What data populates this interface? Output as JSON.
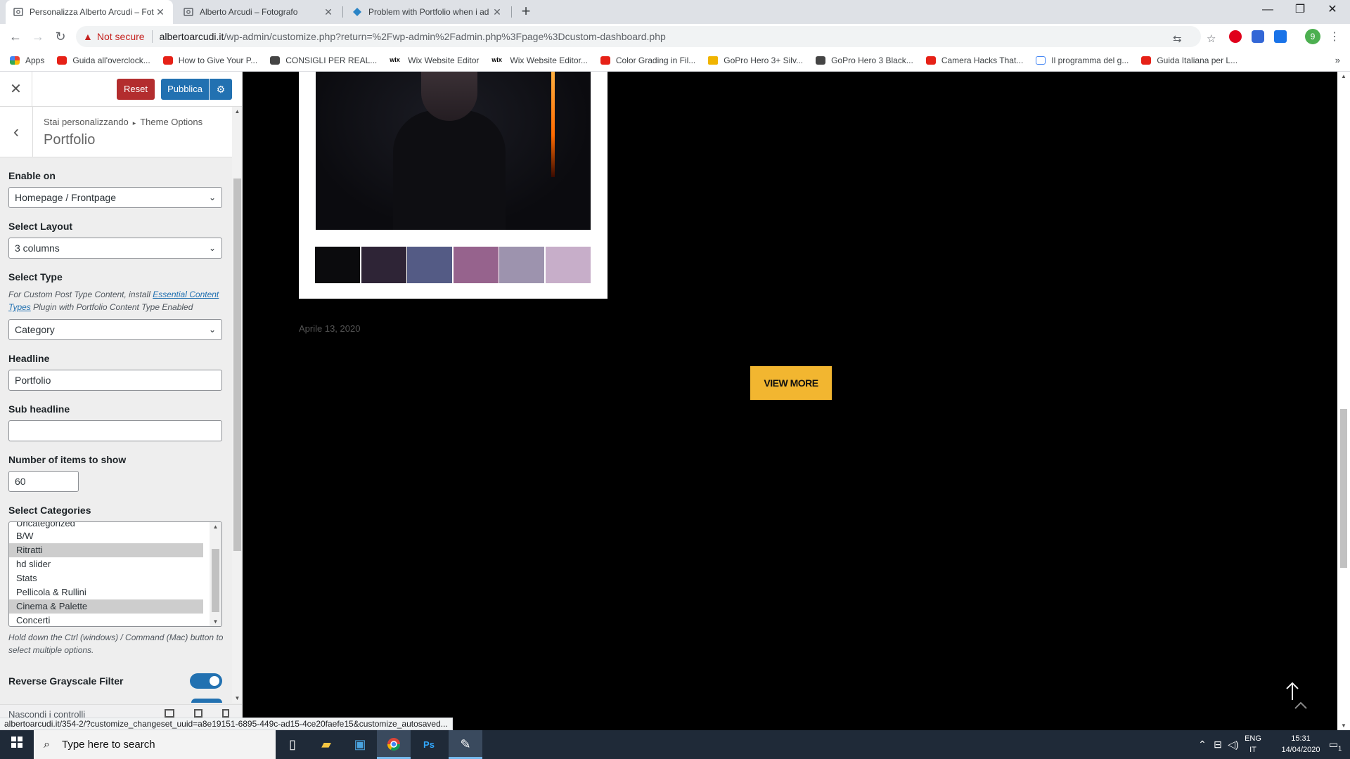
{
  "browser": {
    "tabs": [
      {
        "title": "Personalizza Alberto Arcudi – Fot",
        "active": true
      },
      {
        "title": "Alberto Arcudi – Fotografo",
        "active": false
      },
      {
        "title": "Problem with Portfolio when i ad",
        "active": false
      }
    ],
    "new_tab": "+",
    "window": {
      "minimize": "—",
      "restore": "❐",
      "close": "✕"
    },
    "nav": {
      "back": "←",
      "forward": "→",
      "reload": "↻"
    },
    "not_secure": "Not secure",
    "url_host": "albertoarcudi.it",
    "url_path": "/wp-admin/customize.php?return=%2Fwp-admin%2Fadmin.php%3Fpage%3Dcustom-dashboard.php",
    "profile_initial": "9",
    "bookmarks": [
      {
        "label": "Apps",
        "icon": "grid"
      },
      {
        "label": "Guida all'overclock...",
        "icon": "yt"
      },
      {
        "label": "How to Give Your P...",
        "icon": "yt"
      },
      {
        "label": "CONSIGLI PER REAL...",
        "icon": "gen"
      },
      {
        "label": "Wix Website Editor",
        "icon": "wix"
      },
      {
        "label": "Wix Website Editor...",
        "icon": "wix"
      },
      {
        "label": "Color Grading in Fil...",
        "icon": "yt"
      },
      {
        "label": "GoPro Hero 3+ Silv...",
        "icon": "gopro"
      },
      {
        "label": "GoPro Hero 3 Black...",
        "icon": "gen"
      },
      {
        "label": "Camera Hacks That...",
        "icon": "yt"
      },
      {
        "label": "Il programma del g...",
        "icon": "note"
      },
      {
        "label": "Guida Italiana per L...",
        "icon": "yt"
      }
    ],
    "bookmarks_more": "»"
  },
  "customizer": {
    "close": "✕",
    "reset": "Reset",
    "publish": "Pubblica",
    "gear": "⚙",
    "back": "‹",
    "crumb_prefix": "Stai personalizzando",
    "crumb_parent": "Theme Options",
    "section_title": "Portfolio",
    "enable_on": {
      "label": "Enable on",
      "value": "Homepage / Frontpage"
    },
    "layout": {
      "label": "Select Layout",
      "value": "3 columns"
    },
    "type": {
      "label": "Select Type",
      "desc_before": "For Custom Post Type Content, install",
      "desc_link": "Essential Content Types",
      "desc_after": "Plugin with Portfolio Content Type Enabled",
      "value": "Category"
    },
    "headline": {
      "label": "Headline",
      "value": "Portfolio"
    },
    "sub_headline": {
      "label": "Sub headline",
      "value": ""
    },
    "items": {
      "label": "Number of items to show",
      "value": "60"
    },
    "categories": {
      "label": "Select Categories",
      "partial": "Uncategorized",
      "options": [
        {
          "name": "B/W",
          "selected": false
        },
        {
          "name": "Ritratti",
          "selected": true
        },
        {
          "name": "hd slider",
          "selected": false
        },
        {
          "name": "Stats",
          "selected": false
        },
        {
          "name": "Pellicola & Rullini",
          "selected": false
        },
        {
          "name": "Cinema & Palette",
          "selected": true
        },
        {
          "name": "Concerti",
          "selected": false
        }
      ],
      "hint": "Hold down the Ctrl (windows) / Command (Mac) button to select multiple options."
    },
    "grayscale": {
      "label": "Reverse Grayscale Filter",
      "enabled": true
    },
    "footer_hide": "Nascondi i controlli"
  },
  "preview": {
    "palette": [
      "#0b0b0d",
      "#2e2436",
      "#545b85",
      "#96638d",
      "#9d93ae",
      "#c7aec9"
    ],
    "date": "Aprile 13, 2020",
    "view_more": "VIEW MORE",
    "status_url": "albertoarcudi.it/354-2/?customize_changeset_uuid=a8e19151-6895-449c-ad15-4ce20faefe15&customize_autosaved..."
  },
  "taskbar": {
    "search_placeholder": "Type here to search",
    "lang_top": "ENG",
    "lang_bottom": "IT",
    "time": "15:31",
    "date": "14/04/2020",
    "notif_count": "1"
  }
}
